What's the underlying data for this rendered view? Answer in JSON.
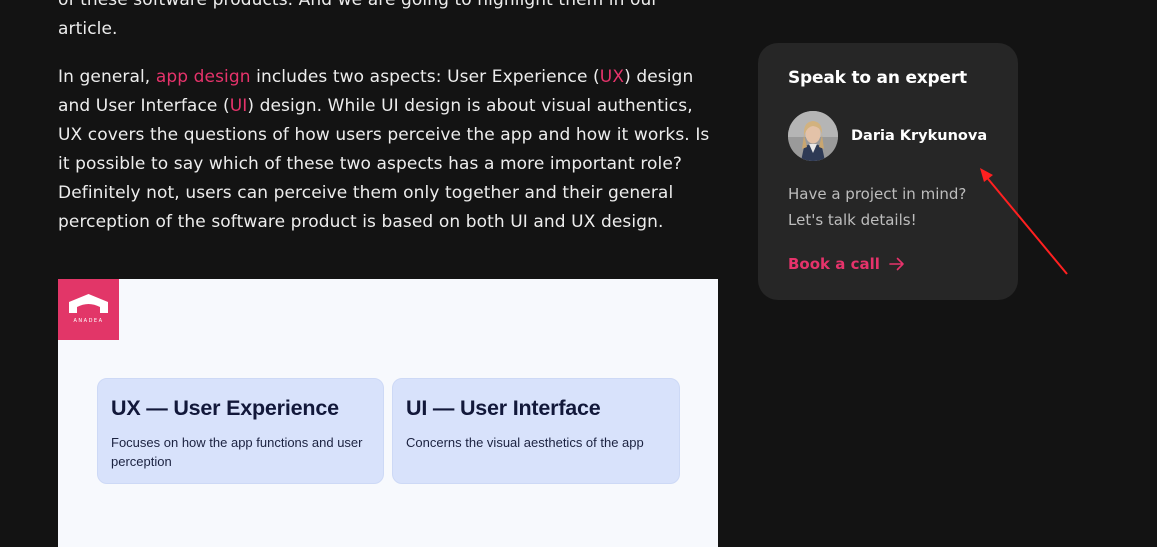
{
  "article": {
    "paragraph1_partial": "of these software products. And we are going to highlight them in our",
    "paragraph1_end": "article.",
    "paragraph2": {
      "part1": "In general, ",
      "link_app_design": "app design",
      "part2": " includes two aspects: User Experience (",
      "link_ux": "UX",
      "part3": ") design and User Interface (",
      "link_ui": "UI",
      "part4": ") design. While UI design is about visual authentics, UX covers the questions of how users perceive the app and how it works. Is it possible to say which of these two aspects has a more important role? Definitely not, users can perceive them only together and their general perception of the software product is based on both UI and UX design."
    },
    "link_color": "#e6336b"
  },
  "figure": {
    "logo_text": "ANADEA",
    "logo_color": "#e23668",
    "ux_card": {
      "title": "UX — User Experience",
      "description": "Focuses on how the app functions and user perception"
    },
    "ui_card": {
      "title": "UI — User Interface",
      "description": "Concerns the visual aesthetics of the app"
    }
  },
  "expert_card": {
    "title": "Speak to an expert",
    "name": "Daria Krykunova",
    "message_line1": "Have a project in mind?",
    "message_line2": "Let's talk details!",
    "cta_label": "Book a call",
    "cta_icon": "arrow-right-icon",
    "accent_color": "#e6336b"
  },
  "annotation": {
    "icon": "red-pointer-arrow",
    "color": "#ff2020"
  }
}
